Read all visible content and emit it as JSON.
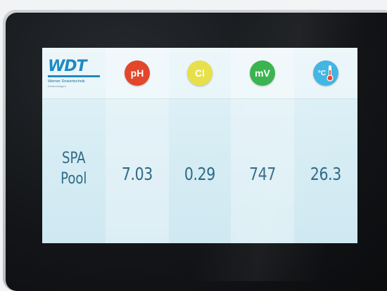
{
  "brand": {
    "logo_text": "WDT",
    "company": "Werner Dosiertechnik",
    "tagline": "Dosieranlagen"
  },
  "columns": [
    {
      "badge": "",
      "value": ""
    },
    {
      "badge": "pH",
      "value": "7.03"
    },
    {
      "badge": "Cl",
      "value": "0.29"
    },
    {
      "badge": "mV",
      "value": "747"
    },
    {
      "badge": "°C",
      "value": "26.3"
    }
  ],
  "location": {
    "line1": "SPA",
    "line2": "Pool"
  },
  "colors": {
    "ph": "#e2462b",
    "cl": "#e8e04a",
    "mv": "#35b24a",
    "temp": "#3fb4e2",
    "value_text": "#2f6a86",
    "brand_blue": "#1e8ac3"
  },
  "icons": {
    "temp": "thermometer-icon"
  }
}
